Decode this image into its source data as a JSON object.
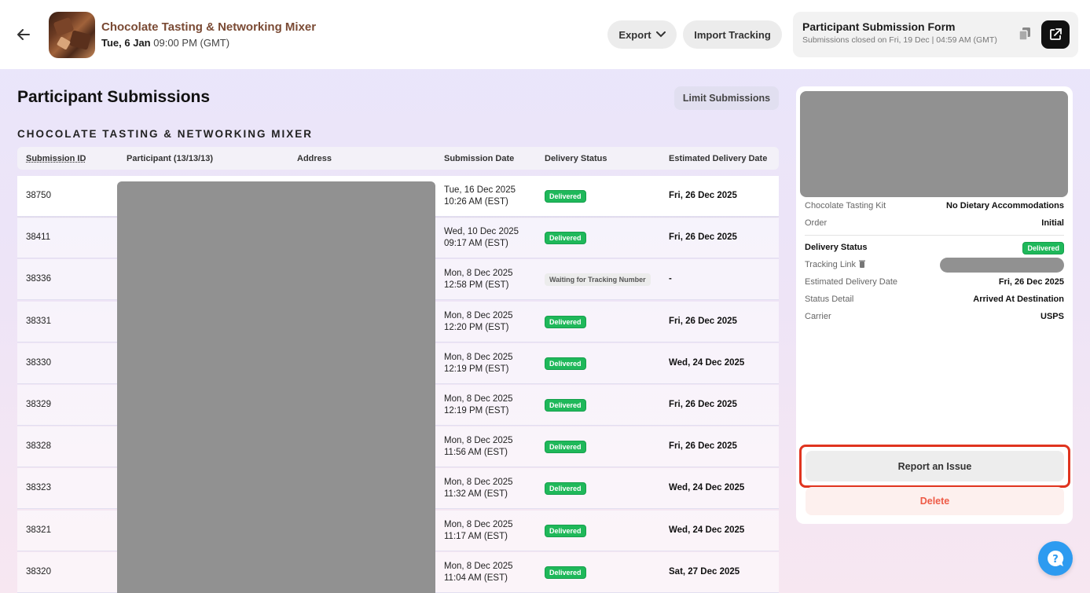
{
  "event": {
    "title": "Chocolate Tasting & Networking Mixer",
    "date_bold": "Tue, 6 Jan",
    "time": "09:00 PM (GMT)"
  },
  "toolbar": {
    "export_label": "Export",
    "import_label": "Import Tracking"
  },
  "form": {
    "title": "Participant Submission Form",
    "subtitle": "Submissions closed on Fri, 19 Dec | 04:59 AM (GMT)"
  },
  "main": {
    "page_title": "Participant Submissions",
    "limit_label": "Limit Submissions",
    "section_title": "CHOCOLATE TASTING & NETWORKING MIXER"
  },
  "table": {
    "columns": [
      "Submission ID",
      "Participant (13/13/13)",
      "Address",
      "Submission Date",
      "Delivery Status",
      "Estimated Delivery Date"
    ],
    "rows": [
      {
        "id": "38750",
        "date1": "Tue, 16 Dec 2025",
        "date2": "10:26 AM (EST)",
        "status": "Delivered",
        "eta": "Fri, 26 Dec 2025"
      },
      {
        "id": "38411",
        "date1": "Wed, 10 Dec 2025",
        "date2": "09:17 AM (EST)",
        "status": "Delivered",
        "eta": "Fri, 26 Dec 2025"
      },
      {
        "id": "38336",
        "date1": "Mon, 8 Dec 2025",
        "date2": "12:58 PM (EST)",
        "status": "Waiting for Tracking Number",
        "eta": "-"
      },
      {
        "id": "38331",
        "date1": "Mon, 8 Dec 2025",
        "date2": "12:20 PM (EST)",
        "status": "Delivered",
        "eta": "Fri, 26 Dec 2025"
      },
      {
        "id": "38330",
        "date1": "Mon, 8 Dec 2025",
        "date2": "12:19 PM (EST)",
        "status": "Delivered",
        "eta": "Wed, 24 Dec 2025"
      },
      {
        "id": "38329",
        "date1": "Mon, 8 Dec 2025",
        "date2": "12:19 PM (EST)",
        "status": "Delivered",
        "eta": "Fri, 26 Dec 2025"
      },
      {
        "id": "38328",
        "date1": "Mon, 8 Dec 2025",
        "date2": "11:56 AM (EST)",
        "status": "Delivered",
        "eta": "Fri, 26 Dec 2025"
      },
      {
        "id": "38323",
        "date1": "Mon, 8 Dec 2025",
        "date2": "11:32 AM (EST)",
        "status": "Delivered",
        "eta": "Wed, 24 Dec 2025"
      },
      {
        "id": "38321",
        "date1": "Mon, 8 Dec 2025",
        "date2": "11:17 AM (EST)",
        "status": "Delivered",
        "eta": "Wed, 24 Dec 2025"
      },
      {
        "id": "38320",
        "date1": "Mon, 8 Dec 2025",
        "date2": "11:04 AM (EST)",
        "status": "Delivered",
        "eta": "Sat, 27 Dec 2025"
      }
    ]
  },
  "detail": {
    "kit_label": "Chocolate Tasting Kit",
    "kit_value": "No Dietary Accommodations",
    "order_label": "Order",
    "order_value": "Initial",
    "delivery_status_label": "Delivery Status",
    "delivery_status_value": "Delivered",
    "tracking_label": "Tracking Link",
    "eta_label": "Estimated Delivery Date",
    "eta_value": "Fri, 26 Dec 2025",
    "status_detail_label": "Status Detail",
    "status_detail_value": "Arrived At Destination",
    "carrier_label": "Carrier",
    "carrier_value": "USPS",
    "report_label": "Report an Issue",
    "delete_label": "Delete"
  },
  "colors": {
    "accent_brown": "#7a4a34",
    "delivered_green": "#1fb85a",
    "delete_red": "#ee5a46",
    "highlight_red": "#e0341f",
    "help_blue": "#2d9bf0"
  }
}
